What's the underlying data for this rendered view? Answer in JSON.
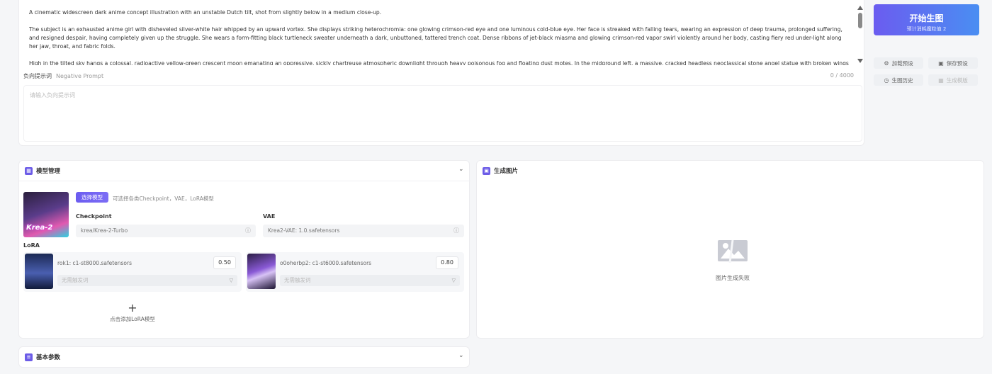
{
  "prompt": {
    "paragraphs": [
      "A cinematic widescreen dark anime concept illustration with an unstable Dutch tilt, shot from slightly below in a medium close-up.",
      "The subject is an exhausted anime girl with disheveled silver-white hair whipped by an upward vortex. She displays striking heterochromia: one glowing crimson-red eye and one luminous cold-blue eye. Her face is streaked with falling tears, wearing an expression of deep trauma, prolonged suffering, and resigned despair, having completely given up the struggle. She wears a form-fitting black turtleneck sweater underneath a dark, unbuttoned, tattered trench coat. Dense ribbons of jet-black miasma and glowing crimson-red vapor swirl violently around her body, casting fiery red under-light along her jaw, throat, and fabric folds.",
      "High in the tilted sky hangs a colossal, radioactive yellow-green crescent moon emanating an oppressive, sickly chartreuse atmospheric downlight through heavy poisonous fog and floating dust motes. In the midground left, a massive, cracked headless neoclassical stone angel statue with broken wings stands silhouetted, its jagged edges catching sharp yellow-green rim light. Wet, reflective asphalt ground below mirrors deep green-black puddles and crimson mist. Sickening toxic acid-green and chartreuse color scheme sharply contrasted with abyssal black and blood red. Rough palette knife textures, heavy chiaroscuro, intense psychological horror and"
    ],
    "negative_label": "负向提示词",
    "negative_label_en": "Negative Prompt",
    "negative_count": "0 / 4000",
    "negative_placeholder": "请输入负向提示词"
  },
  "actions": {
    "generate_main": "开始生图",
    "generate_sub": "预计消耗魔粒值 2",
    "load_preset": "加载预设",
    "save_preset": "保存预设",
    "history": "生图历史",
    "generate_template": "生成模版"
  },
  "model_panel": {
    "title": "模型管理",
    "thumb_label": "Krea-2",
    "select_button": "选择模型",
    "select_hint": "可选择各类Checkpoint，VAE，LoRA模型",
    "checkpoint_label": "Checkpoint",
    "checkpoint_value": "krea/Krea-2-Turbo",
    "vae_label": "VAE",
    "vae_value": "Krea2-VAE: 1.0.safetensors",
    "lora_label": "LoRA",
    "loras": [
      {
        "name": "rok1: c1-st8000.safetensors",
        "weight": "0.50",
        "trigger_placeholder": "无需触发词"
      },
      {
        "name": "o0oherbp2: c1-st6000.safetensors",
        "weight": "0.80",
        "trigger_placeholder": "无需触发词"
      }
    ],
    "add_lora": "点击添加LoRA模型"
  },
  "image_panel": {
    "title": "生成图片",
    "status": "图片生成失败"
  },
  "basic_panel": {
    "title": "基本参数"
  },
  "colors": {
    "accent": "#6b5cf0",
    "accent2": "#4a8ef2"
  }
}
